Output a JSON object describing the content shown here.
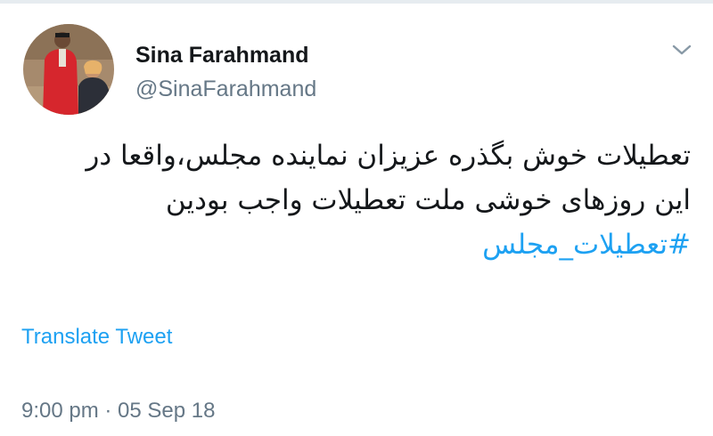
{
  "author": {
    "display_name": "Sina Farahmand",
    "handle": "@SinaFarahmand",
    "avatar_icon": "profile-photo"
  },
  "tweet": {
    "line1": "تعطیلات خوش بگذره عزیزان نماینده مجلس،واقعا در",
    "line2": "این روزهای خوشی ملت تعطیلات واجب بودین",
    "hashtag": "#تعطیلات_مجلس"
  },
  "actions": {
    "translate_label": "Translate Tweet",
    "menu_icon": "chevron-down-icon"
  },
  "meta": {
    "timestamp": "9:00 pm · 05 Sep 18"
  },
  "colors": {
    "link": "#1da1f2",
    "secondary_text": "#657786",
    "primary_text": "#14171a"
  }
}
